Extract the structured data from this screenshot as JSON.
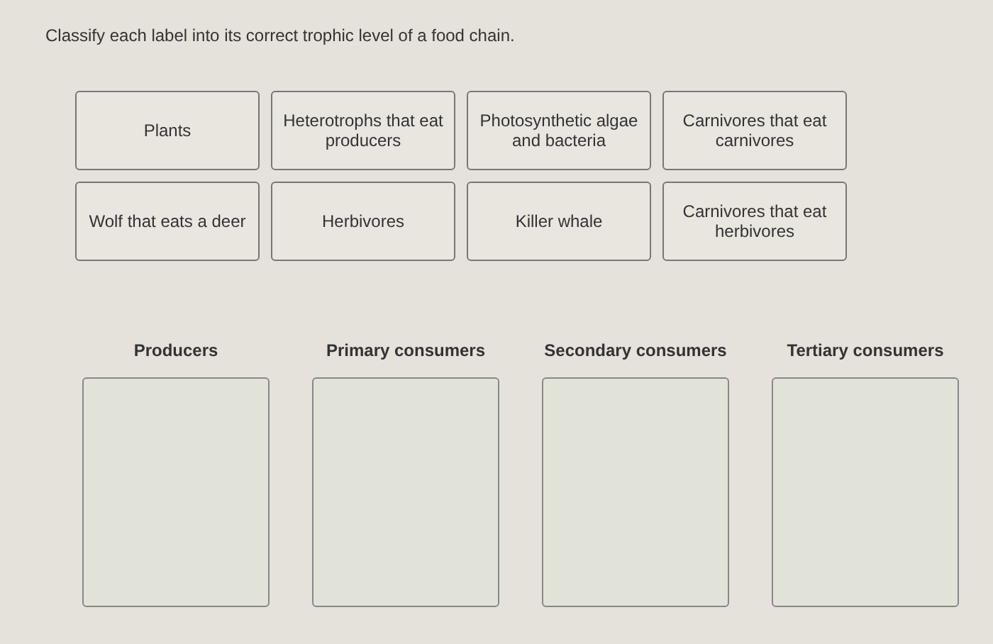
{
  "instruction": "Classify each label into its correct trophic level of a food chain.",
  "labels": [
    "Plants",
    "Heterotrophs that eat producers",
    "Photosynthetic algae and bacteria",
    "Carnivores that eat carnivores",
    "Wolf that eats a deer",
    "Herbivores",
    "Killer whale",
    "Carnivores that eat herbivores"
  ],
  "bins": [
    {
      "title": "Producers"
    },
    {
      "title": "Primary consumers"
    },
    {
      "title": "Secondary consumers"
    },
    {
      "title": "Tertiary consumers"
    }
  ]
}
